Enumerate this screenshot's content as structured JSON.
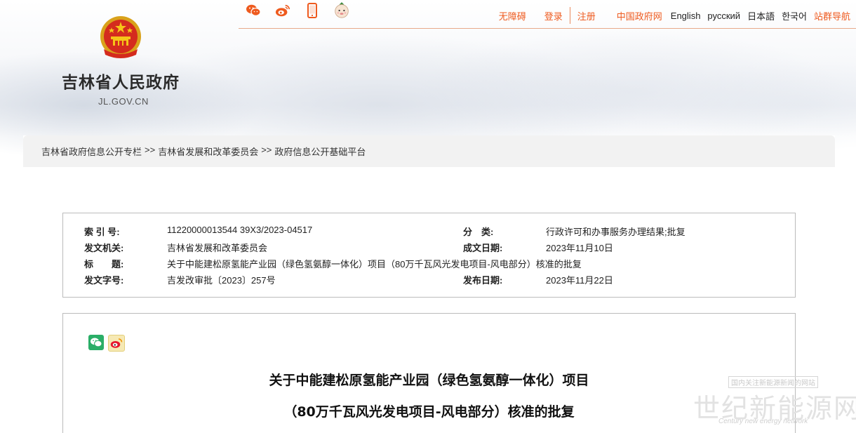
{
  "header": {
    "site_title": "吉林省人民政府",
    "site_domain": "JL.GOV.CN",
    "social_icons": [
      "wechat-icon",
      "weibo-icon",
      "mobile-icon",
      "mascot-icon"
    ],
    "links": {
      "accessibility": "无障碍",
      "login": "登录",
      "register": "注册",
      "gov_portal": "中国政府网",
      "english": "English",
      "russian": "русский",
      "japanese": "日本語",
      "korean": "한국어",
      "site_nav": "站群导航"
    }
  },
  "breadcrumb": {
    "items": [
      "吉林省政府信息公开专栏",
      "吉林省发展和改革委员会",
      "政府信息公开基础平台"
    ],
    "separator": ">>"
  },
  "meta": {
    "index_label": "索 引 号:",
    "index_value": "11220000013544 39X3/2023-04517",
    "category_label": "分　类:",
    "category_value": "行政许可和办事服务办理结果;批复",
    "issuer_label": "发文机关:",
    "issuer_value": "吉林省发展和改革委员会",
    "created_label": "成文日期:",
    "created_value": "2023年11月10日",
    "title_label": "标　　题:",
    "title_value": "关于中能建松原氢能产业园（绿色氢氨醇一体化）项目（80万千瓦风光发电项目-风电部分）核准的批复",
    "docno_label": "发文字号:",
    "docno_value": "吉发改审批〔2023〕257号",
    "published_label": "发布日期:",
    "published_value": "2023年11月22日"
  },
  "document": {
    "title_line1": "关于中能建松原氢能产业园（绿色氢氨醇一体化）项目",
    "title_line2": "（80万千瓦风光发电项目-风电部分）核准的批复",
    "share_icons": [
      "wechat-share-icon",
      "weibo-share-icon"
    ]
  },
  "watermark": {
    "tagline": "国内关注新能源新闻的网站",
    "name": "世纪新能源网",
    "english": "Century new energy network"
  },
  "colors": {
    "accent": "#ee5a1e",
    "wechat": "#2aae67",
    "weibo": "#e6162d"
  }
}
